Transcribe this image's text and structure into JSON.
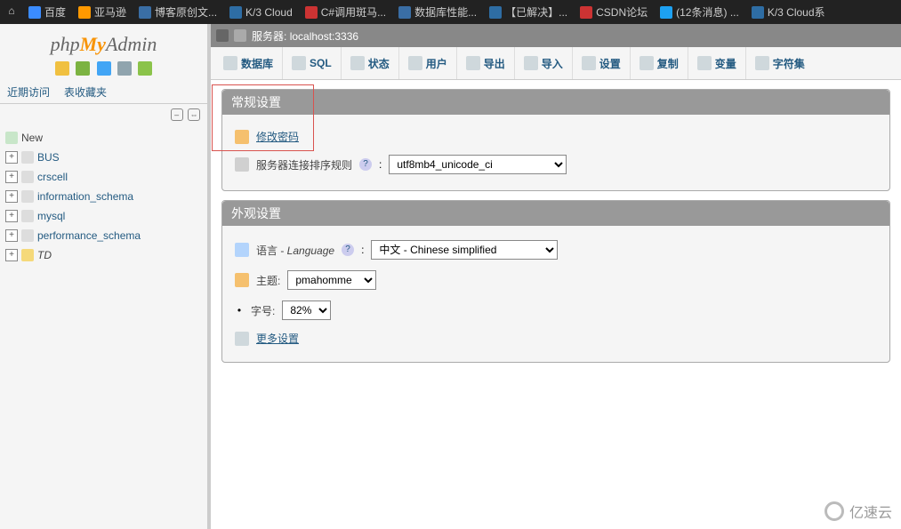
{
  "browser": {
    "tabs": [
      {
        "label": "百度",
        "icon": "baidu"
      },
      {
        "label": "亚马逊",
        "icon": "amazon"
      },
      {
        "label": "博客原创文...",
        "icon": "blog"
      },
      {
        "label": "K/3 Cloud",
        "icon": "k3"
      },
      {
        "label": "C#调用斑马...",
        "icon": "csdn-c"
      },
      {
        "label": "数据库性能...",
        "icon": "blog"
      },
      {
        "label": "【已解决】...",
        "icon": "k"
      },
      {
        "label": "CSDN论坛",
        "icon": "csdn-c"
      },
      {
        "label": "(12条消息) ...",
        "icon": "msg"
      },
      {
        "label": "K/3 Cloud系",
        "icon": "k"
      }
    ]
  },
  "sidebar": {
    "recent": "近期访问",
    "favorites": "表收藏夹",
    "nodes": [
      {
        "label": "New",
        "type": "new"
      },
      {
        "label": "BUS"
      },
      {
        "label": "crscell"
      },
      {
        "label": "information_schema"
      },
      {
        "label": "mysql"
      },
      {
        "label": "performance_schema"
      },
      {
        "label": "TD",
        "selected": true
      }
    ]
  },
  "server": {
    "prefix": "服务器:",
    "value": "localhost:3336"
  },
  "main_tabs": [
    {
      "label": "数据库",
      "icon": "db"
    },
    {
      "label": "SQL",
      "icon": "sql"
    },
    {
      "label": "状态",
      "icon": "status"
    },
    {
      "label": "用户",
      "icon": "users"
    },
    {
      "label": "导出",
      "icon": "export"
    },
    {
      "label": "导入",
      "icon": "import"
    },
    {
      "label": "设置",
      "icon": "settings"
    },
    {
      "label": "复制",
      "icon": "replication"
    },
    {
      "label": "变量",
      "icon": "vars"
    },
    {
      "label": "字符集",
      "icon": "charset"
    }
  ],
  "general": {
    "title": "常规设置",
    "change_password": "修改密码",
    "collation_label": "服务器连接排序规则",
    "collation_value": "utf8mb4_unicode_ci"
  },
  "appearance": {
    "title": "外观设置",
    "language_label": "语言 - ",
    "language_italic": "Language",
    "language_value": "中文 - Chinese simplified",
    "theme_label": "主题:",
    "theme_value": "pmahomme",
    "font_label": "字号:",
    "font_value": "82%",
    "more": "更多设置"
  },
  "watermark": "亿速云"
}
